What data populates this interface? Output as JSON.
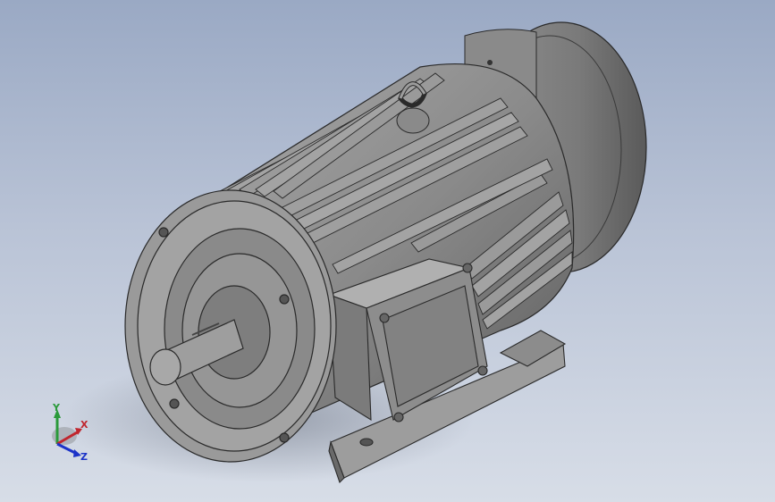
{
  "viewport": {
    "background_top": "#9aa9c4",
    "background_bottom": "#d7dde7"
  },
  "model": {
    "subject": "electric-motor",
    "body_color": "#8c8c8c",
    "shade_color": "#5c5c5c",
    "highlight_color": "#c0c0c0"
  },
  "triad": {
    "labels": {
      "x": "X",
      "y": "Y",
      "z": "Z"
    },
    "colors": {
      "x": "#c0262e",
      "y": "#2a9a3a",
      "z": "#1c33c8"
    }
  }
}
